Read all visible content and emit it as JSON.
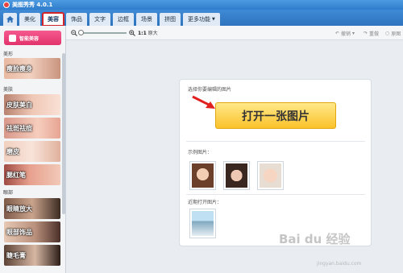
{
  "window": {
    "title": "美图秀秀 4.0.1"
  },
  "nav": {
    "tabs": [
      {
        "label": "美化"
      },
      {
        "label": "美容"
      },
      {
        "label": "饰品"
      },
      {
        "label": "文字"
      },
      {
        "label": "边框"
      },
      {
        "label": "场景"
      },
      {
        "label": "拼图"
      },
      {
        "label": "更多功能"
      }
    ],
    "active_tab": "美容"
  },
  "toolbar": {
    "actual_size": "1:1",
    "actual_size_label": "原大",
    "undo": "撤销",
    "redo": "重做",
    "reset": "原图"
  },
  "sidebar": {
    "smart_button": "智能美容",
    "sections": [
      {
        "label": "美形",
        "items": [
          {
            "label": "瘦脸瘦身"
          }
        ]
      },
      {
        "label": "美肤",
        "items": [
          {
            "label": "皮肤美白"
          },
          {
            "label": "祛斑祛痘"
          },
          {
            "label": "磨皮"
          },
          {
            "label": "腮红笔"
          }
        ]
      },
      {
        "label": "眼部",
        "items": [
          {
            "label": "眼睛放大"
          },
          {
            "label": "眼部饰品"
          },
          {
            "label": "睫毛膏"
          }
        ]
      }
    ]
  },
  "main": {
    "prompt": "选择你要编辑的图片",
    "open_button": "打开一张图片",
    "sample_label": "示例图片：",
    "recent_label": "近期打开图片："
  },
  "watermark": {
    "text": "Bai du 经验",
    "sub": "jingyan.baidu.com"
  },
  "colors": {
    "accent": "#2f7ccc",
    "active_outline": "#d3242a",
    "open_button": "#fbc22a",
    "smart_button": "#e2326c"
  }
}
